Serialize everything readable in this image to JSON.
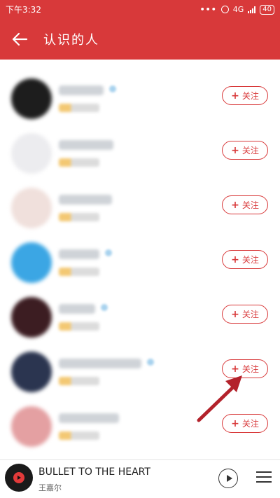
{
  "status_bar": {
    "time": "下午3:32",
    "network": "4G",
    "battery": "40"
  },
  "header": {
    "title": "认识的人"
  },
  "colors": {
    "brand": "#d8393a"
  },
  "people": [
    {
      "follow_label": "关注",
      "avatar_color": "#1d1d1d",
      "name_width": 50
    },
    {
      "follow_label": "关注",
      "avatar_color": "#ececef",
      "name_width": 56
    },
    {
      "follow_label": "关注",
      "avatar_color": "#f0e0dc",
      "name_width": 60
    },
    {
      "follow_label": "关注",
      "avatar_color": "#3ba6e4",
      "name_width": 44
    },
    {
      "follow_label": "关注",
      "avatar_color": "#3c1d22",
      "name_width": 42
    },
    {
      "follow_label": "关注",
      "avatar_color": "#2b3550",
      "name_width": 96
    },
    {
      "follow_label": "关注",
      "avatar_color": "#e4a0a2",
      "name_width": 70
    }
  ],
  "player": {
    "song": "BULLET TO THE HEART",
    "artist": "王嘉尔"
  }
}
